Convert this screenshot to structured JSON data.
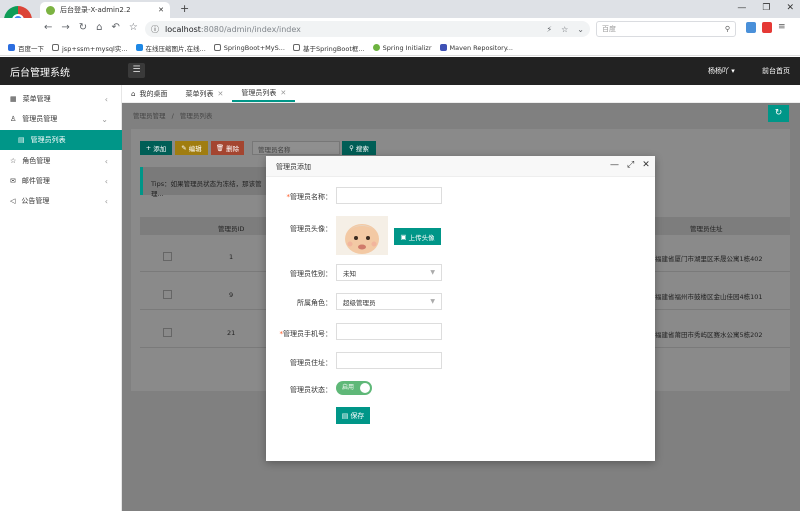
{
  "browser": {
    "tab_title": "后台登录-X-admin2.2",
    "new_tab": "+",
    "url_host": "localhost",
    "url_path": ":8080/admin/index/index",
    "search_placeholder": "百度",
    "bookmarks": [
      "百度一下",
      "jsp+ssm+mysql实...",
      "在线压缩图片,在线...",
      "SpringBoot+MyS...",
      "基于SpringBoot框...",
      "Spring Initializr",
      "Maven Repository..."
    ]
  },
  "header": {
    "app_title": "后台管理系统",
    "user": "杨杨吖",
    "home_link": "前台首页"
  },
  "sidebar": {
    "items": [
      {
        "label": "菜单管理"
      },
      {
        "label": "管理员管理"
      },
      {
        "label": "管理员列表"
      },
      {
        "label": "角色管理"
      },
      {
        "label": "邮件管理"
      },
      {
        "label": "公告管理"
      }
    ]
  },
  "tabs": [
    {
      "label": "我的桌面"
    },
    {
      "label": "菜单列表"
    },
    {
      "label": "管理员列表"
    }
  ],
  "breadcrumb": {
    "a": "管理员管理",
    "sep": "/",
    "b": "管理员列表"
  },
  "toolbar": {
    "add": "添加",
    "edit": "编辑",
    "delete": "删除",
    "search_placeholder": "管理员名称",
    "search": "搜索"
  },
  "tips": "Tips：如果管理员状态为冻结，那该管理...",
  "table": {
    "headers": [
      "管理员ID",
      "管理员住址"
    ],
    "rows": [
      {
        "id": "1",
        "address": "福建省厦门市湖里区禾晟公寓1栋402"
      },
      {
        "id": "9",
        "address": "福建省福州市鼓楼区金山佳园4栋101"
      },
      {
        "id": "21",
        "address": "福建省莆田市秀屿区赛水公寓5栋202"
      }
    ]
  },
  "modal": {
    "title": "管理员添加",
    "labels": {
      "name": "管理员名称：",
      "avatar": "管理员头像：",
      "gender": "管理员性别：",
      "role": "所属角色：",
      "phone": "管理员手机号：",
      "address": "管理员住址：",
      "status": "管理员状态："
    },
    "required_mark": "*",
    "upload": "上传头像",
    "gender_value": "未知",
    "role_value": "超级管理员",
    "status_value": "启用",
    "save": "保存"
  },
  "colors": {
    "accent": "#009688",
    "switch_on": "#5fb878",
    "edit_btn": "#ffb800",
    "delete_btn": "#ff5722",
    "header_bg": "#222222"
  }
}
